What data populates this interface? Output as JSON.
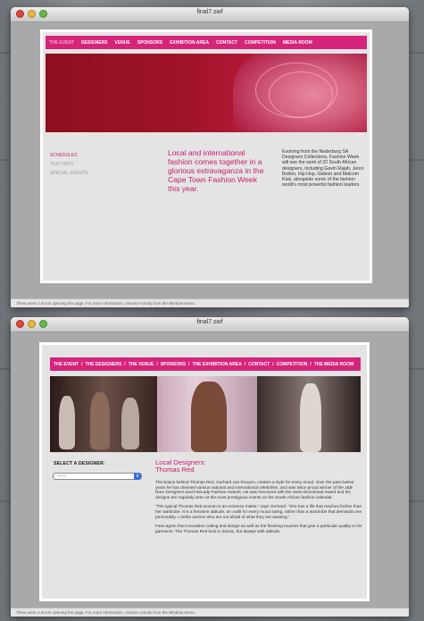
{
  "windows": [
    {
      "title": "final7.swf",
      "status": "There were 2 errors opening the page. For more information, choose Activity from the Window menu.",
      "nav": [
        "THE EVENT",
        "DESIGNERS",
        "VENUE",
        "SPONSORS",
        "EXHIBITION AREA",
        "CONTACT",
        "COMPETITION",
        "MEDIA ROOM"
      ],
      "sidenav": [
        "SCHEDULES",
        "TEXT INFO",
        "SPECIAL EVENTS"
      ],
      "tagline": "Local and international fashion comes together in a glorious extravaganza in the Cape Town Fashion Week this year.",
      "blurb": "Evolving from the Nederburg SA Designers Collections, Fashion Week will see the work of 22 South African designers, including Gavin Rajah, Jenni Button, Hip Hop, Gideon and Malcom Kluk, alongside some of the fashion world's most powerful fashion leaders."
    },
    {
      "title": "final7.swf",
      "status": "There were 2 errors opening the page. For more information, choose Activity from the Window menu.",
      "nav": [
        "THE EVENT",
        "THE DESIGNERS",
        "THE VENUE",
        "SPONSORS",
        "THE EXHIBITION AREA",
        "CONTACT",
        "COMPETITION",
        "THE MEDIA ROOM"
      ],
      "nav_separator": "/",
      "select_label": "SELECT A DESIGNER:",
      "dropdown_value": "------",
      "dropdown_arrow": "⇕",
      "heading_line1": "Local Designers:",
      "heading_line2": "Thomas Red",
      "paragraphs": [
        "The brains behind Thomas Red, Gerhard van Rooyen, creates a style for every mood. Over the past twelve years he has dressed various national and international celebrities, and was twice proud winner of the J&B Rare Designers and FairLady Fashion Awards. He was honoured with the Sans Directional Award and his designs are regularly seen at the most prestigious events on the South African fashion calendar.",
        "\"The typical Thomas Red woman is an entrance maker,\" says Gerhard. \"She has a life that reaches further than her wardrobe. It is a feminine attitude, an outfit for every mood swing, rather than a wardrobe that demands one personality. I clothe women who are not afraid of what they are wearing.\"",
        "Fans agree that innovative cutting and design as well as the finishing touches that give a particular quality to his garments. The Thomas Red look is classic, but always with attitude."
      ]
    }
  ],
  "colors": {
    "accent": "#d6247b",
    "heading": "#c41e6a",
    "hero_red": "#a01428"
  }
}
